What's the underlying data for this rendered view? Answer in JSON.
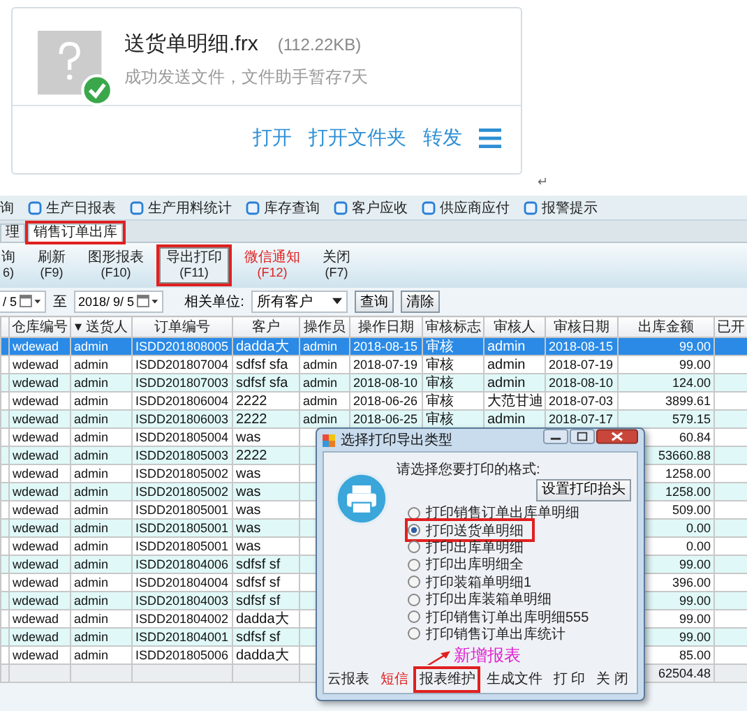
{
  "file_card": {
    "file_name": "送货单明细.frx",
    "file_size": "(112.22KB)",
    "status": "成功发送文件，文件助手暂存7天",
    "actions": [
      "打开",
      "打开文件夹",
      "转发"
    ]
  },
  "paragraph_mark": "↵",
  "quick_links": [
    {
      "label": "询",
      "kind": "cut"
    },
    {
      "label": "生产日报表",
      "kind": "link"
    },
    {
      "label": "生产用料统计",
      "kind": "link"
    },
    {
      "label": "库存查询",
      "kind": "link"
    },
    {
      "label": "客户应收",
      "kind": "link"
    },
    {
      "label": "供应商应付",
      "kind": "link"
    },
    {
      "label": "报警提示",
      "kind": "link"
    }
  ],
  "tabs": [
    {
      "label": "理",
      "selected": false,
      "highlighted": false
    },
    {
      "label": "销售订单出库",
      "selected": true,
      "highlighted": true
    }
  ],
  "toolbar": [
    {
      "label": "询",
      "key": "6)",
      "highlighted": false,
      "alert": false
    },
    {
      "label": "刷新",
      "key": "(F9)",
      "highlighted": false,
      "alert": false
    },
    {
      "label": "图形报表",
      "key": "(F10)",
      "highlighted": false,
      "alert": false
    },
    {
      "label": "导出打印",
      "key": "(F11)",
      "highlighted": true,
      "alert": false
    },
    {
      "label": "微信通知",
      "key": "(F12)",
      "highlighted": false,
      "alert": true
    },
    {
      "label": "关闭",
      "key": "(F7)",
      "highlighted": false,
      "alert": false
    }
  ],
  "filter": {
    "date_from": "/ 5",
    "to_label": "至",
    "date_to": "2018/ 9/ 5",
    "unit_label": "相关单位:",
    "unit_value": "所有客户",
    "buttons": [
      "查询",
      "清除"
    ]
  },
  "table": {
    "columns": [
      "仓库编号",
      "▾ 送货人",
      "订单编号",
      "客户",
      "操作员",
      "操作日期",
      "审核标志",
      "审核人",
      "审核日期",
      "出库金额",
      "已开"
    ],
    "rows": [
      {
        "selected": true,
        "warehouse": "wdewad",
        "handler": "admin",
        "order_no": "ISDD201808005",
        "customer": "dadda大",
        "operator": "admin",
        "op_date": "2018-08-15",
        "audit_flag": "审核",
        "auditor": "admin",
        "audit_date": "2018-08-15",
        "amount": "99.00"
      },
      {
        "selected": false,
        "warehouse": "wdewad",
        "handler": "admin",
        "order_no": "ISDD201807004",
        "customer": "sdfsf sfa",
        "operator": "admin",
        "op_date": "2018-07-19",
        "audit_flag": "审核",
        "auditor": "admin",
        "audit_date": "2018-07-19",
        "amount": "99.00"
      },
      {
        "selected": false,
        "warehouse": "wdewad",
        "handler": "admin",
        "order_no": "ISDD201807003",
        "customer": "sdfsf sfa",
        "operator": "admin",
        "op_date": "2018-08-10",
        "audit_flag": "审核",
        "auditor": "admin",
        "audit_date": "2018-08-10",
        "amount": "124.00"
      },
      {
        "selected": false,
        "warehouse": "wdewad",
        "handler": "admin",
        "order_no": "ISDD201806004",
        "customer": "2222",
        "operator": "admin",
        "op_date": "2018-06-26",
        "audit_flag": "审核",
        "auditor": "大范甘迪",
        "audit_date": "2018-07-03",
        "amount": "3899.61"
      },
      {
        "selected": false,
        "warehouse": "wdewad",
        "handler": "admin",
        "order_no": "ISDD201806003",
        "customer": "2222",
        "operator": "admin",
        "op_date": "2018-06-25",
        "audit_flag": "审核",
        "auditor": "admin",
        "audit_date": "2018-07-17",
        "amount": "579.15"
      },
      {
        "selected": false,
        "warehouse": "wdewad",
        "handler": "admin",
        "order_no": "ISDD201805004",
        "customer": "was",
        "amount": "60.84"
      },
      {
        "selected": false,
        "warehouse": "wdewad",
        "handler": "admin",
        "order_no": "ISDD201805003",
        "customer": "2222",
        "amount": "53660.88"
      },
      {
        "selected": false,
        "warehouse": "wdewad",
        "handler": "admin",
        "order_no": "ISDD201805002",
        "customer": "was",
        "amount": "1258.00"
      },
      {
        "selected": false,
        "warehouse": "wdewad",
        "handler": "admin",
        "order_no": "ISDD201805002",
        "customer": "was",
        "amount": "1258.00"
      },
      {
        "selected": false,
        "warehouse": "wdewad",
        "handler": "admin",
        "order_no": "ISDD201805001",
        "customer": "was",
        "amount": "509.00"
      },
      {
        "selected": false,
        "warehouse": "wdewad",
        "handler": "admin",
        "order_no": "ISDD201805001",
        "customer": "was",
        "amount": "0.00"
      },
      {
        "selected": false,
        "warehouse": "wdewad",
        "handler": "admin",
        "order_no": "ISDD201805001",
        "customer": "was",
        "amount": "0.00"
      },
      {
        "selected": false,
        "warehouse": "wdewad",
        "handler": "admin",
        "order_no": "ISDD201804006",
        "customer": "sdfsf sf",
        "amount": "99.00"
      },
      {
        "selected": false,
        "warehouse": "wdewad",
        "handler": "admin",
        "order_no": "ISDD201804004",
        "customer": "sdfsf sf",
        "amount": "396.00"
      },
      {
        "selected": false,
        "warehouse": "wdewad",
        "handler": "admin",
        "order_no": "ISDD201804003",
        "customer": "sdfsf sf",
        "amount": "99.00"
      },
      {
        "selected": false,
        "warehouse": "wdewad",
        "handler": "admin",
        "order_no": "ISDD201804002",
        "customer": "dadda大",
        "amount": "99.00"
      },
      {
        "selected": false,
        "warehouse": "wdewad",
        "handler": "admin",
        "order_no": "ISDD201804001",
        "customer": "sdfsf sf",
        "amount": "99.00"
      },
      {
        "selected": false,
        "warehouse": "wdewad",
        "handler": "admin",
        "order_no": "ISDD201805006",
        "customer": "dadda大",
        "amount": "85.00"
      }
    ],
    "total_amount": "62504.48"
  },
  "dialog": {
    "title": "选择打印导出类型",
    "prompt": "请选择您要打印的格式:",
    "header_button": "设置打印抬头",
    "options": [
      {
        "label": "打印销售订单出库单明细",
        "selected": false,
        "highlighted": false
      },
      {
        "label": "打印送货单明细",
        "selected": true,
        "highlighted": true
      },
      {
        "label": "打印出库单明细",
        "selected": false,
        "highlighted": false
      },
      {
        "label": "打印出库明细全",
        "selected": false,
        "highlighted": false
      },
      {
        "label": "打印装箱单明细1",
        "selected": false,
        "highlighted": false
      },
      {
        "label": "打印出库装箱单明细",
        "selected": false,
        "highlighted": false
      },
      {
        "label": "打印销售订单出库明细555",
        "selected": false,
        "highlighted": false
      },
      {
        "label": "打印销售订单出库统计",
        "selected": false,
        "highlighted": false
      }
    ],
    "footer": [
      {
        "label": "云报表",
        "alert": false,
        "highlighted": false
      },
      {
        "label": "短信",
        "alert": true,
        "highlighted": false
      },
      {
        "label": "报表维护",
        "alert": false,
        "highlighted": true
      },
      {
        "label": "生成文件",
        "alert": false,
        "highlighted": false
      },
      {
        "label": "打 印",
        "alert": false,
        "highlighted": false
      },
      {
        "label": "关 闭",
        "alert": false,
        "highlighted": false
      }
    ],
    "annotation": "新增报表"
  }
}
